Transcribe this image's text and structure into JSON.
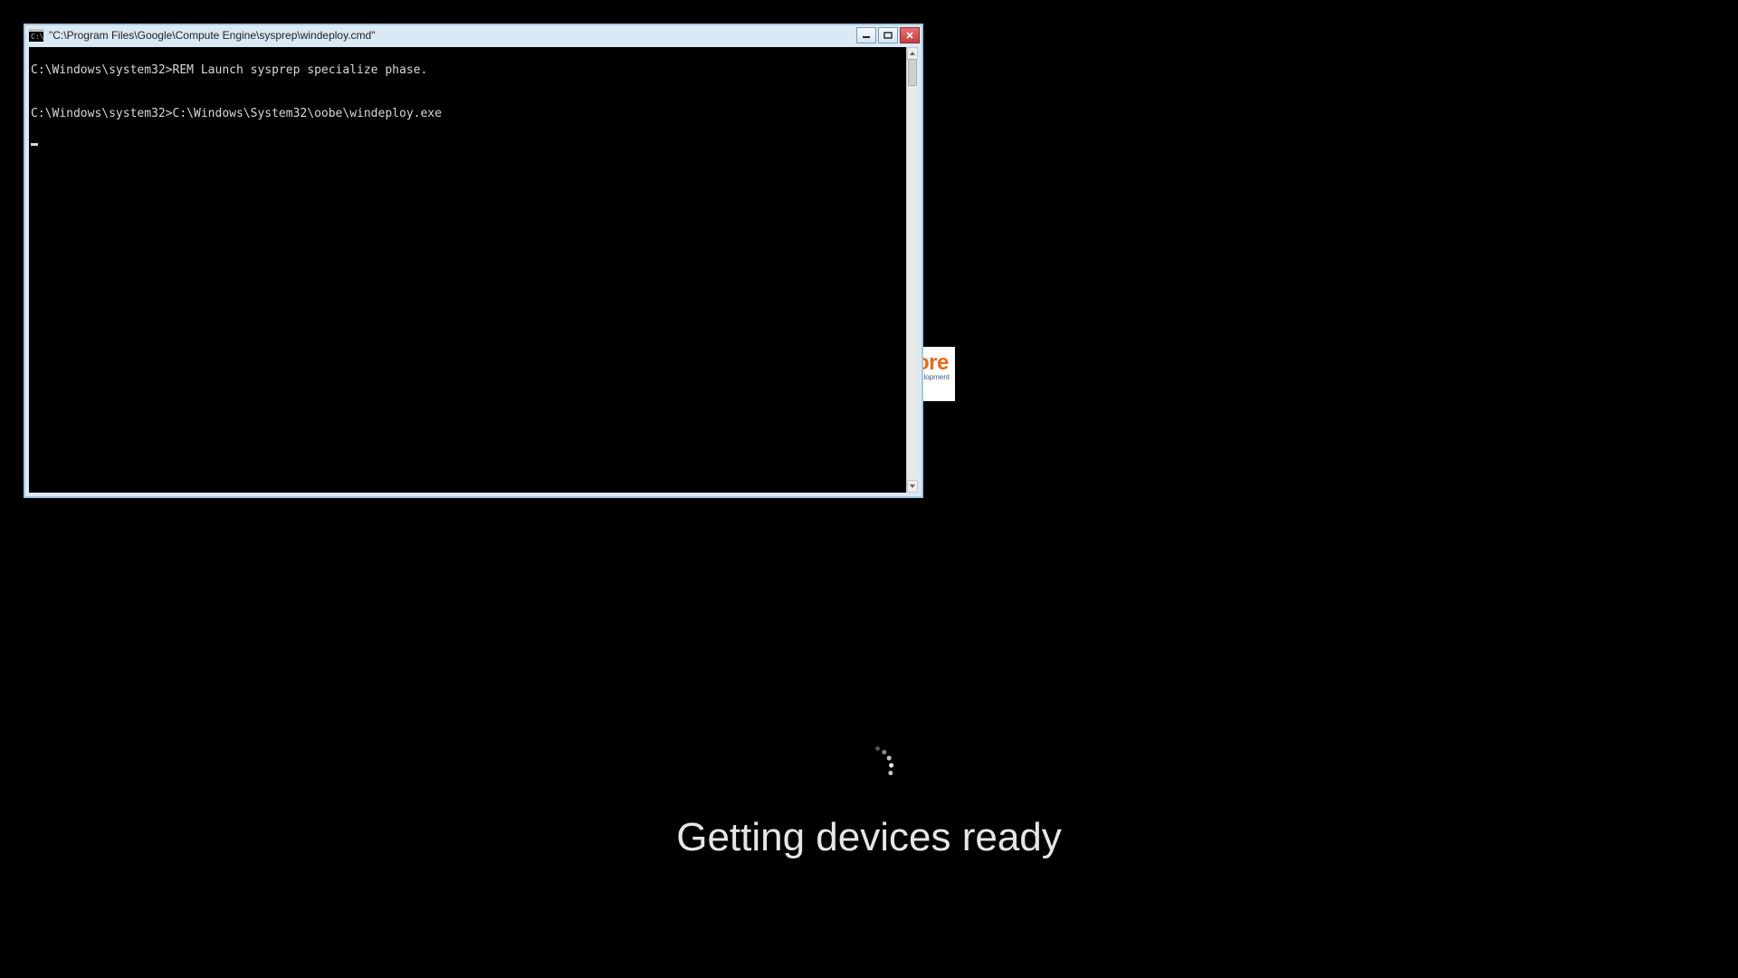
{
  "oobe": {
    "message": "Getting devices ready"
  },
  "badge": {
    "text_fragment_top": "ore",
    "text_fragment_bottom": "velopment"
  },
  "cmd_window": {
    "title": "\"C:\\Program Files\\Google\\Compute Engine\\sysprep\\windeploy.cmd\"",
    "lines": [
      "C:\\Windows\\system32>REM Launch sysprep specialize phase.",
      "",
      "C:\\Windows\\system32>C:\\Windows\\System32\\oobe\\windeploy.exe"
    ]
  }
}
